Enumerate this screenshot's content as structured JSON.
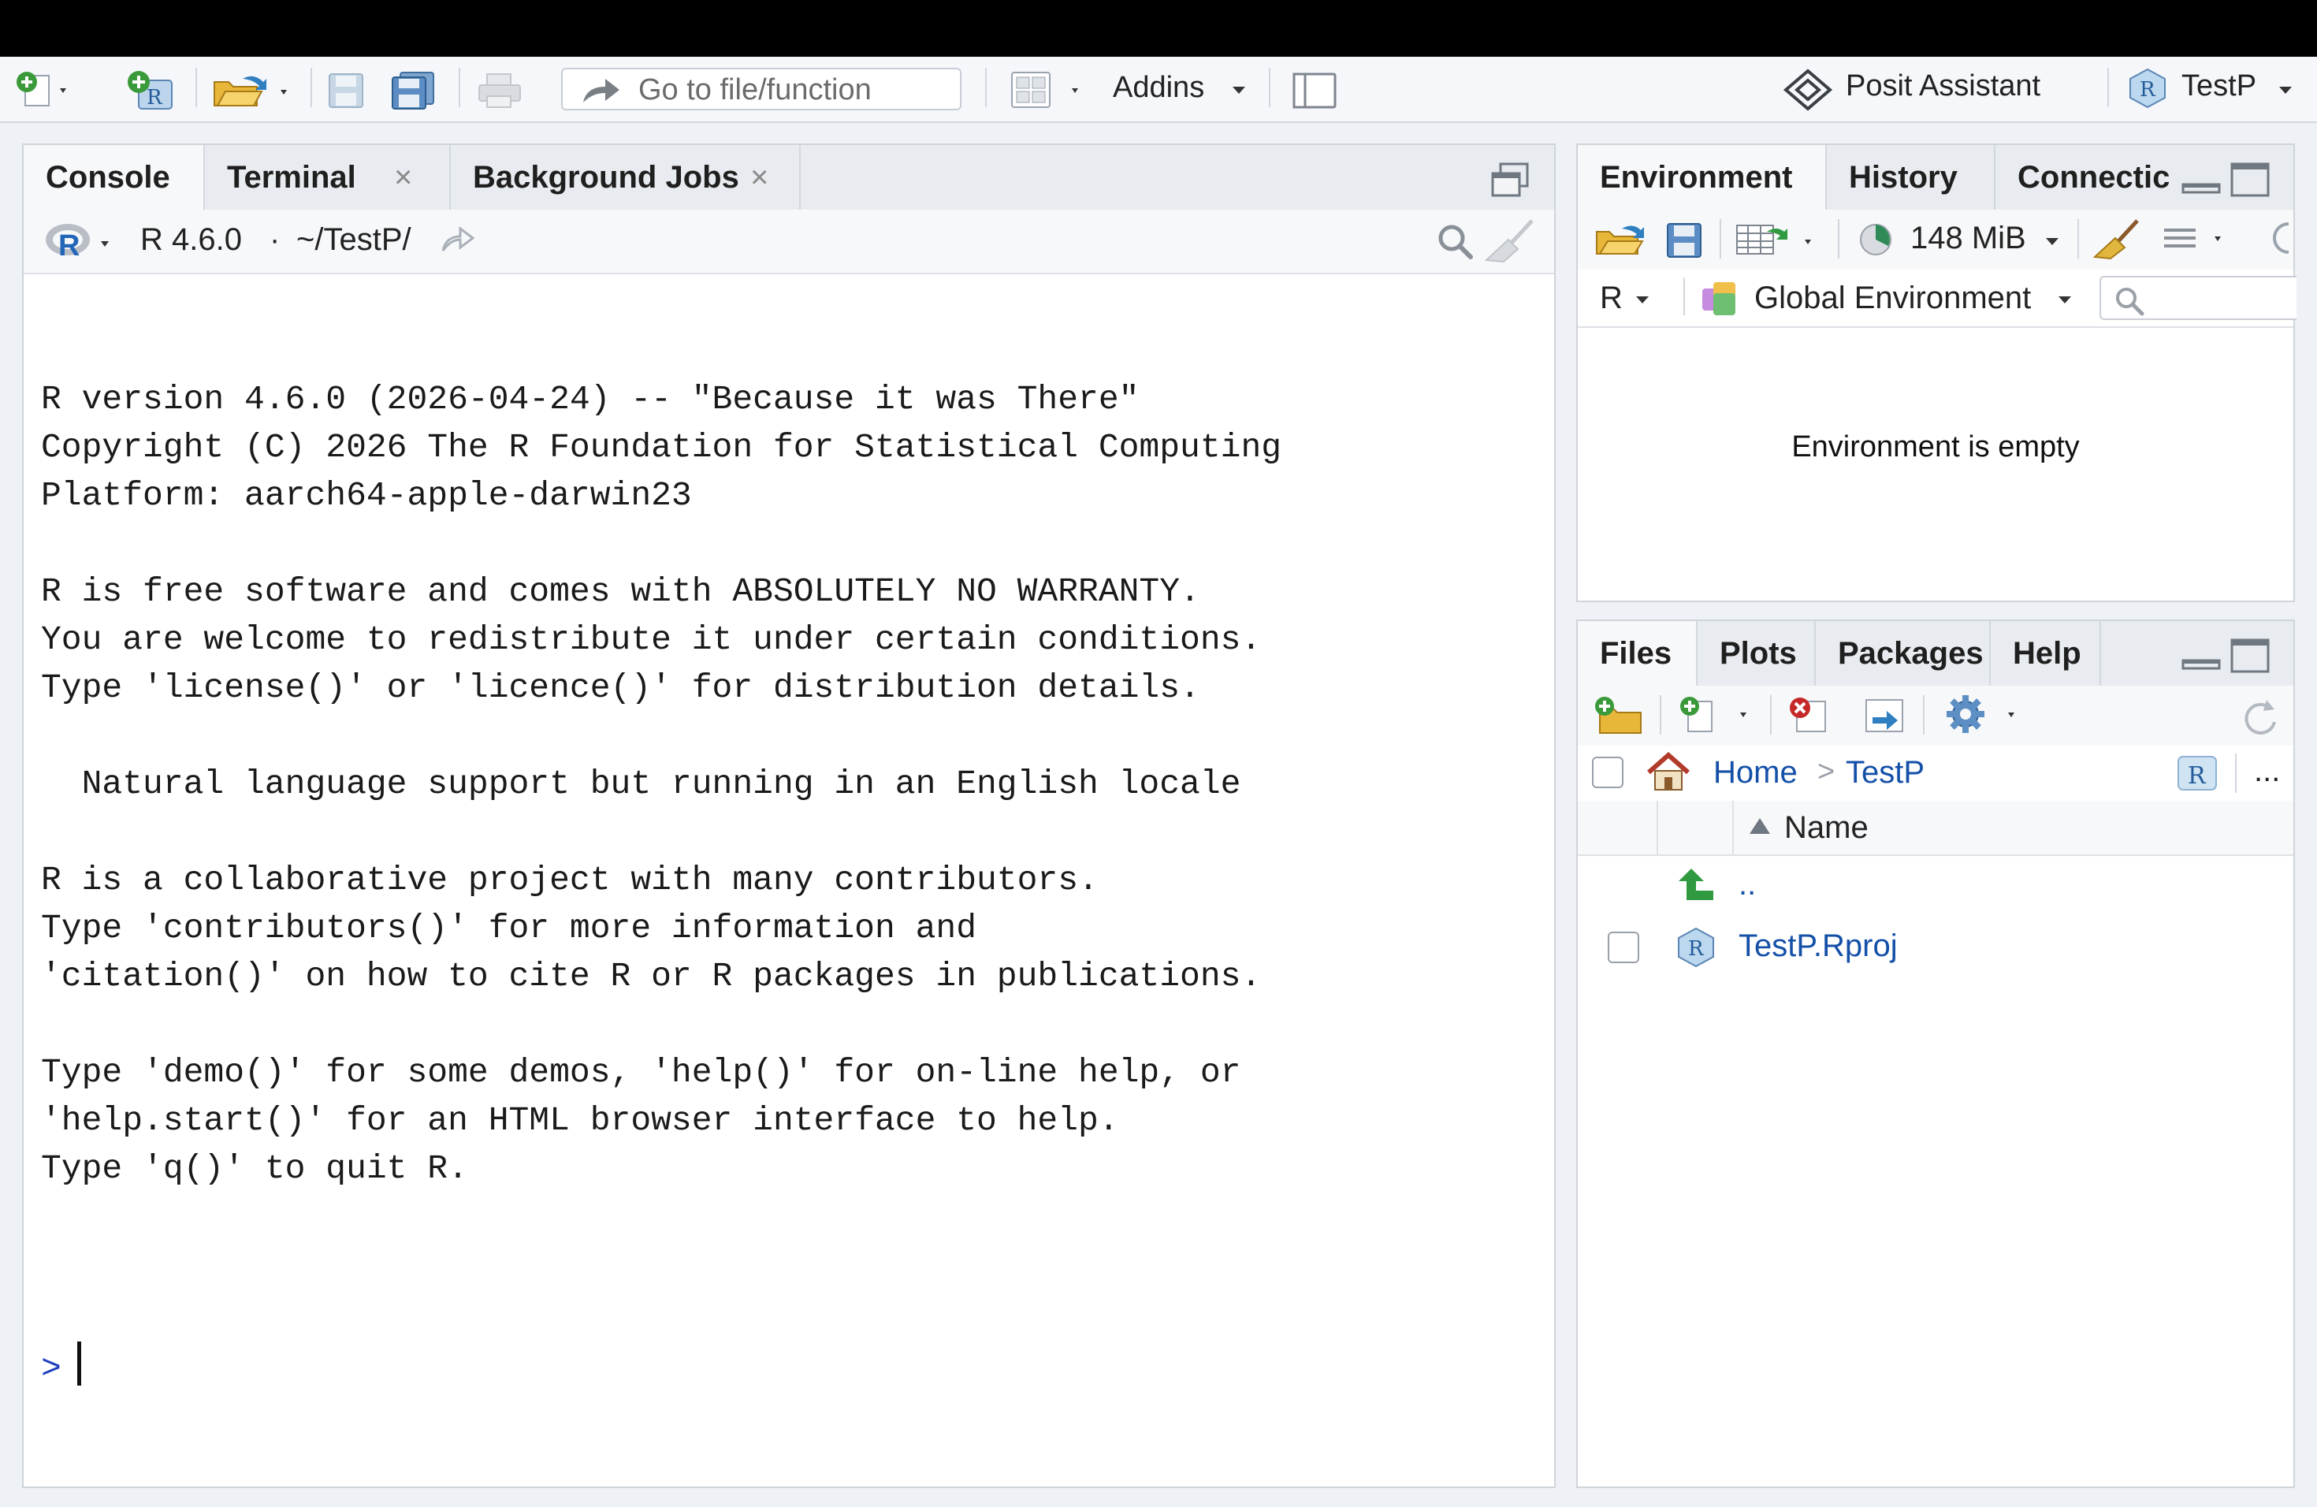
{
  "toolbar": {
    "goto_placeholder": "Go to file/function",
    "addins_label": "Addins",
    "assistant_label": "Posit Assistant",
    "project_label": "TestP"
  },
  "console_pane": {
    "tabs": [
      {
        "label": "Console",
        "closable": false,
        "active": true
      },
      {
        "label": "Terminal",
        "closable": true,
        "active": false
      },
      {
        "label": "Background Jobs",
        "closable": true,
        "active": false
      }
    ],
    "r_version": "R 4.6.0",
    "separator": "·",
    "path": "~/TestP/",
    "output_lines": [
      "R version 4.6.0 (2026-04-24) -- \"Because it was There\"",
      "Copyright (C) 2026 The R Foundation for Statistical Computing",
      "Platform: aarch64-apple-darwin23",
      "",
      "R is free software and comes with ABSOLUTELY NO WARRANTY.",
      "You are welcome to redistribute it under certain conditions.",
      "Type 'license()' or 'licence()' for distribution details.",
      "",
      "  Natural language support but running in an English locale",
      "",
      "R is a collaborative project with many contributors.",
      "Type 'contributors()' for more information and",
      "'citation()' on how to cite R or R packages in publications.",
      "",
      "Type 'demo()' for some demos, 'help()' for on-line help, or",
      "'help.start()' for an HTML browser interface to help.",
      "Type 'q()' to quit R.",
      ""
    ],
    "prompt": ">"
  },
  "env_pane": {
    "tabs": [
      {
        "label": "Environment",
        "active": true
      },
      {
        "label": "History",
        "active": false
      },
      {
        "label": "Connectic",
        "active": false
      }
    ],
    "memory": "148 MiB",
    "language": "R",
    "scope": "Global Environment",
    "empty_message": "Environment is empty"
  },
  "files_pane": {
    "tabs": [
      {
        "label": "Files",
        "active": true
      },
      {
        "label": "Plots",
        "active": false
      },
      {
        "label": "Packages",
        "active": false
      },
      {
        "label": "Help",
        "active": false
      }
    ],
    "breadcrumb": {
      "home": "Home",
      "sep": ">",
      "current": "TestP"
    },
    "more": "...",
    "column_name": "Name",
    "rows": [
      {
        "name": "..",
        "type": "parent"
      },
      {
        "name": "TestP.Rproj",
        "type": "rproj"
      }
    ]
  },
  "colors": {
    "accent_link": "#1450a8",
    "prompt": "#1f3fbf",
    "pane_border": "#cfd4da",
    "tabbar_bg": "#e8ebef"
  }
}
